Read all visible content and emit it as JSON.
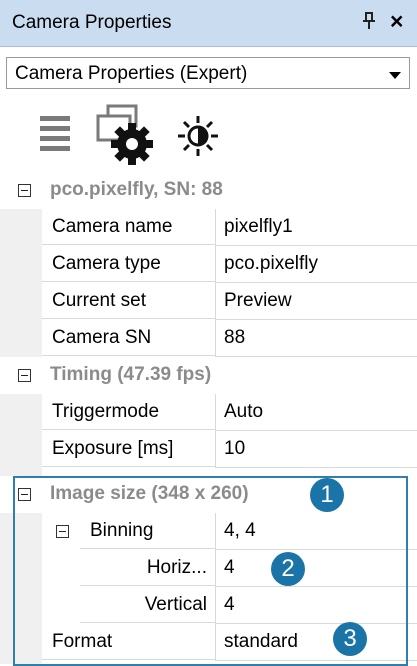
{
  "panel": {
    "title": "Camera Properties",
    "pin_glyph": "Ԅ",
    "close_glyph": "×"
  },
  "view_select": {
    "value": "Camera Properties (Expert)"
  },
  "toolbar": {
    "icons": [
      "list-icon",
      "camera-settings-icon",
      "brightness-icon"
    ]
  },
  "categories": {
    "camera": {
      "title": "pco.pixelfly, SN: 88",
      "rows": [
        {
          "name": "Camera name",
          "value": "pixelfly1"
        },
        {
          "name": "Camera type",
          "value": "pco.pixelfly"
        },
        {
          "name": "Current set",
          "value": "Preview"
        },
        {
          "name": "Camera SN",
          "value": "88"
        }
      ]
    },
    "timing": {
      "title": "Timing (47.39 fps)",
      "rows": [
        {
          "name": "Triggermode",
          "value": "Auto"
        },
        {
          "name": "Exposure [ms]",
          "value": "10"
        }
      ]
    },
    "image_size": {
      "title": "Image size (348 x 260)",
      "binning": {
        "name": "Binning",
        "value": "4, 4"
      },
      "horizontal": {
        "name": "Horiz...",
        "value": "4"
      },
      "vertical": {
        "name": "Vertical",
        "value": "4"
      },
      "format": {
        "name": "Format",
        "value": "standard"
      }
    }
  },
  "callouts": [
    "1",
    "2",
    "3"
  ],
  "colors": {
    "titlebar": "#c9dcf0",
    "category_text": "#8b8b8b",
    "callout": "#1b74a8"
  }
}
